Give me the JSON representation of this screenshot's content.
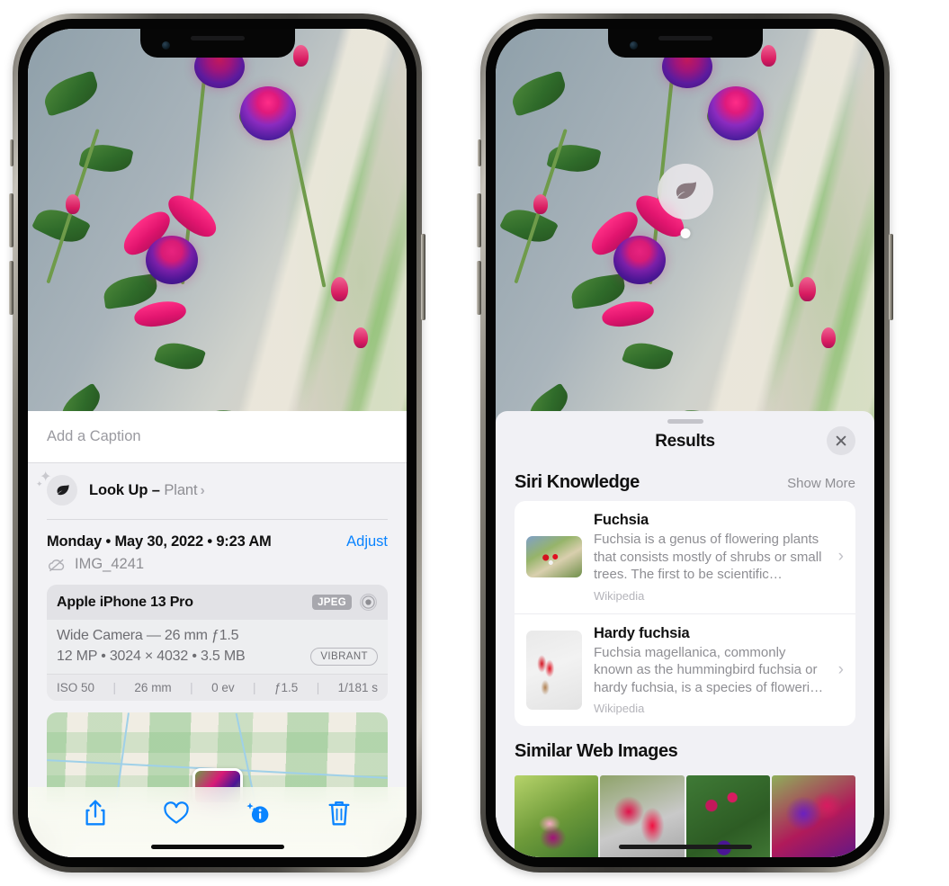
{
  "left_phone": {
    "caption": {
      "placeholder": "Add a Caption",
      "value": ""
    },
    "lookup": {
      "label": "Look Up – ",
      "subject": "Plant",
      "chevron": "›",
      "icon": "leaf-icon"
    },
    "datetime": "Monday • May 30, 2022 • 9:23 AM",
    "adjust_label": "Adjust",
    "filename": "IMG_4241",
    "filename_icon": "cloud-slash-icon",
    "exif": {
      "device": "Apple iPhone 13 Pro",
      "format_badge": "JPEG",
      "lens_icon": "aperture-icon",
      "lens_line": "Wide Camera — 26 mm ƒ1.5",
      "size_line": "12 MP • 3024 × 4032 • 3.5 MB",
      "style_badge": "VIBRANT",
      "stats": [
        "ISO 50",
        "26 mm",
        "0 ev",
        "ƒ1.5",
        "1/181 s"
      ],
      "separator": "|"
    },
    "toolbar": [
      {
        "name": "share-button",
        "icon": "share-icon"
      },
      {
        "name": "favorite-button",
        "icon": "heart-icon"
      },
      {
        "name": "info-button",
        "icon": "info-sparkle-icon"
      },
      {
        "name": "delete-button",
        "icon": "trash-icon"
      }
    ]
  },
  "right_phone": {
    "visual_lookup_badge": {
      "icon": "leaf-icon"
    },
    "sheet": {
      "title": "Results",
      "close_icon": "close-icon",
      "sections": [
        {
          "title": "Siri Knowledge",
          "action": "Show More",
          "items": [
            {
              "title": "Fuchsia",
              "description": "Fuchsia is a genus of flowering plants that consists mostly of shrubs or small trees. The first to be scientific…",
              "source": "Wikipedia",
              "chevron": "›"
            },
            {
              "title": "Hardy fuchsia",
              "description": "Fuchsia magellanica, commonly known as the hummingbird fuchsia or hardy fuchsia, is a species of floweri…",
              "source": "Wikipedia",
              "chevron": "›"
            }
          ]
        },
        {
          "title": "Similar Web Images",
          "images": [
            "web-image-1",
            "web-image-2",
            "web-image-3",
            "web-image-4"
          ]
        }
      ]
    }
  },
  "colors": {
    "accent_blue": "#0a84ff",
    "sheet_bg": "#f1f1f5",
    "card_bg": "#ffffff",
    "secondary_text": "#8e8e93"
  }
}
